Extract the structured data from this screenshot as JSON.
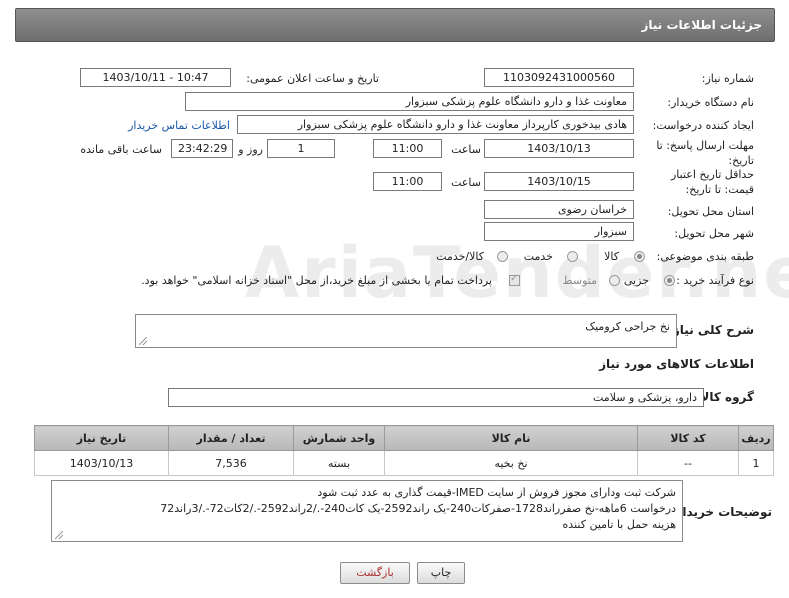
{
  "header": {
    "title": "جزئیات اطلاعات نیاز"
  },
  "watermark": "AriaTender.neT",
  "fields": {
    "need_number_label": "شماره نیاز:",
    "need_number": "1103092431000560",
    "announce_label": "تاریخ و ساعت اعلان عمومی:",
    "announce_value": "1403/10/11 - 10:47",
    "buyer_org_label": "نام دستگاه خریدار:",
    "buyer_org": "معاونت غذا و دارو   دانشگاه علوم پزشکی سبزوار",
    "creator_label": "ایجاد کننده درخواست:",
    "creator": "هادی بیدخوری کارپرداز معاونت غذا و دارو   دانشگاه علوم پزشکی سبزوار",
    "contact_link": "اطلاعات تماس خریدار",
    "deadline_label": "مهلت ارسال پاسخ: تا تاریخ:",
    "deadline_date": "1403/10/13",
    "time_label": "ساعت",
    "deadline_time": "11:00",
    "days_value": "1",
    "days_label": "روز و",
    "remaining_time": "23:42:29",
    "remaining_label": "ساعت باقی مانده",
    "min_validity_label": "حداقل تاریخ اعتبار قیمت: تا تاریخ:",
    "validity_date": "1403/10/15",
    "validity_time": "11:00",
    "province_label": "استان محل تحویل:",
    "province": "خراسان رضوی",
    "city_label": "شهر محل تحویل:",
    "city": "سبزوار",
    "category_label": "طبقه بندی موضوعی:",
    "category_options": [
      "کالا",
      "خدمت",
      "کالا/خدمت"
    ],
    "category_selected": "کالا",
    "process_label": "نوع فرآیند خرید :",
    "process_options": [
      "جزیی",
      "متوسط"
    ],
    "process_selected": "جزیی",
    "payment_note": "پرداخت تمام یا بخشی از مبلغ خرید،از محل \"اسناد خزانه اسلامی\" خواهد بود."
  },
  "summary": {
    "label": "شرح کلی نیاز:",
    "value": "نخ جراحی کرومیک"
  },
  "goods_section": {
    "title": "اطلاعات کالاهای مورد نیاز",
    "group_label": "گروه کالا:",
    "group_value": "دارو، پزشکی و سلامت"
  },
  "table": {
    "headers": [
      "ردیف",
      "کد کالا",
      "نام کالا",
      "واحد شمارش",
      "تعداد / مقدار",
      "تاریخ نیاز"
    ],
    "rows": [
      [
        "1",
        "--",
        "نخ بخیه",
        "بسته",
        "7,536",
        "1403/10/13"
      ]
    ]
  },
  "buyer_notes": {
    "label": "توضیحات خریدار:",
    "lines": [
      "شرکت ثبت ودارای مجوز فروش از سایت IMED-قیمت گذاری به عدد ثبت شود",
      "درخواست 6ماهه-نخ صفرراند1728-صفرکات240-یک راند2592-یک کات240-./2راند2592-./2کات72-./3راند72",
      "هزینه حمل با تامین کننده"
    ]
  },
  "buttons": {
    "print": "چاپ",
    "back": "بازگشت"
  },
  "colors": {
    "header_bg": "#7f7f7f",
    "link": "#1a57a8",
    "back_text": "#b03030"
  }
}
